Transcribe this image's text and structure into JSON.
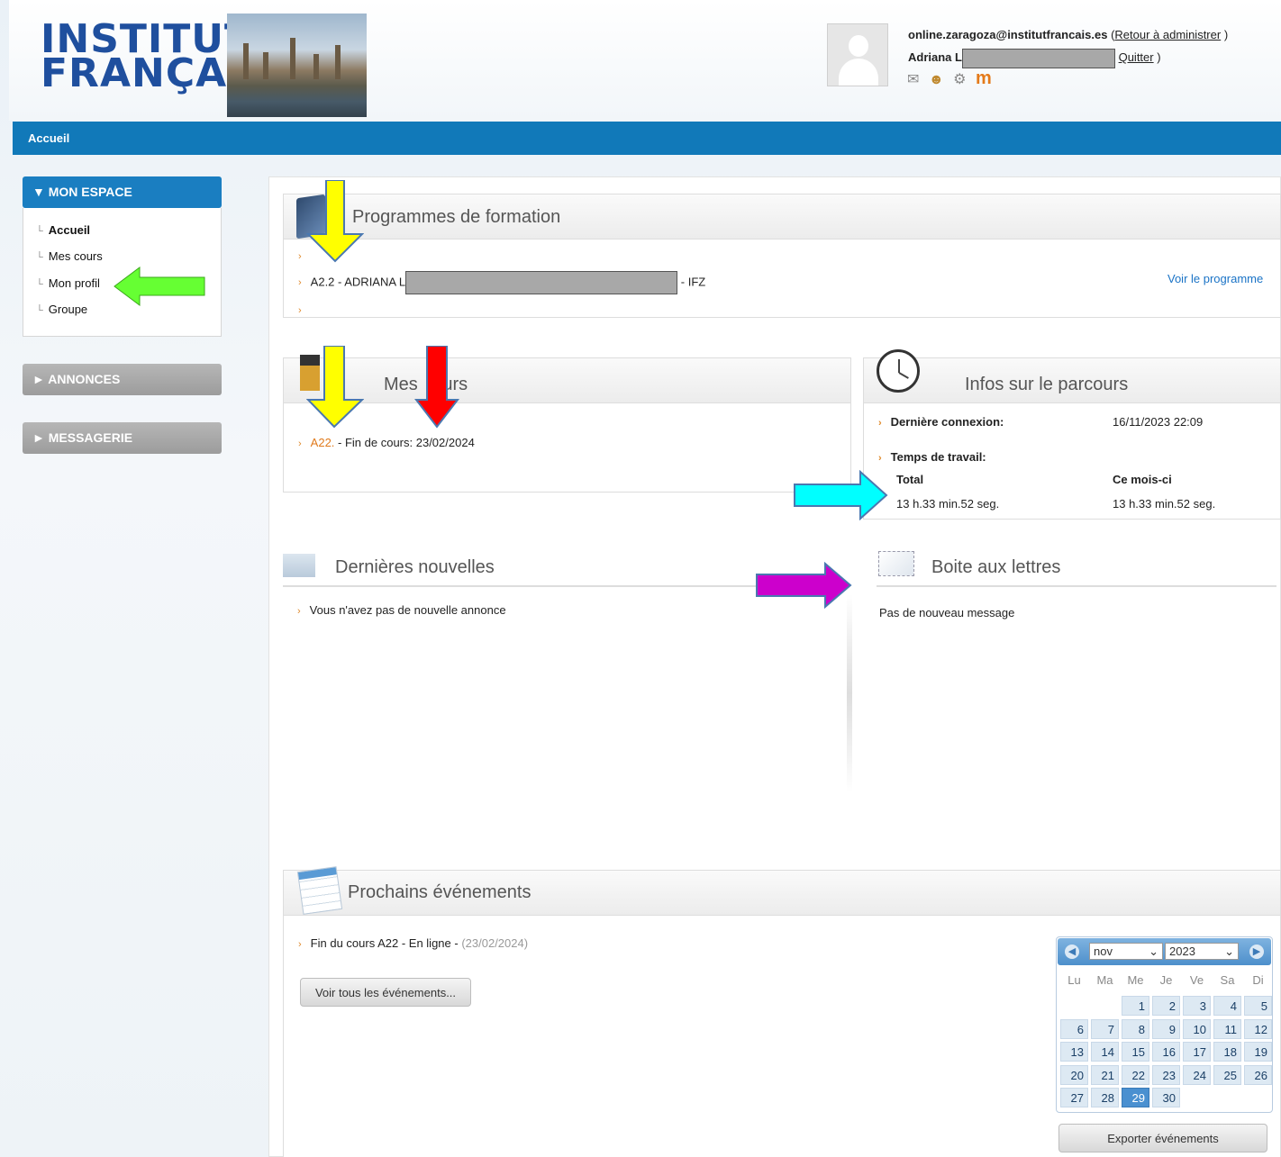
{
  "header": {
    "logo_line1": "INSTITUT",
    "logo_line2": "FRANÇAIS",
    "email": "online.zaragoza@institutfrancais.es",
    "paren_open": "(",
    "paren_close": ")",
    "return_admin": "Retour à administrer",
    "user_name": "Adriana L",
    "quit": "Quitter",
    "icons": [
      "mail-icon",
      "user-icon",
      "gear-icon",
      "moodle-icon"
    ]
  },
  "nav": {
    "home_tab": "Accueil"
  },
  "sidebar": {
    "mon_espace": "▼ MON ESPACE",
    "items": [
      {
        "label": "Accueil",
        "active": true
      },
      {
        "label": "Mes cours"
      },
      {
        "label": "Mon profil"
      },
      {
        "label": "Groupe"
      }
    ],
    "annonces": "► ANNONCES",
    "messagerie": "► MESSAGERIE"
  },
  "programmes": {
    "title": "Programmes de formation",
    "entry_prefix": "A2.2 - ADRIANA L",
    "entry_suffix": "- IFZ",
    "view_link": "Voir le programme"
  },
  "mes_cours": {
    "title_a": "Mes",
    "title_b": "urs",
    "course_link": "A22.",
    "course_text": " - Fin de cours: 23/02/2024"
  },
  "infos": {
    "title": "Infos sur le parcours",
    "last_login_label": "Dernière connexion:",
    "last_login_value": "16/11/2023 22:09",
    "work_time_label": "Temps de travail:",
    "total_label": "Total",
    "month_label": "Ce mois-ci",
    "total_value": "13 h.33 min.52 seg.",
    "month_value": "13 h.33 min.52 seg."
  },
  "news": {
    "title": "Dernières nouvelles",
    "empty": "Vous n'avez pas de nouvelle annonce"
  },
  "mailbox": {
    "title": "Boite aux lettres",
    "empty": "Pas de nouveau message"
  },
  "events": {
    "title": "Prochains événements",
    "item_text": "Fin du cours A22 - En ligne - ",
    "item_date": "(23/02/2024)",
    "view_all": "Voir tous les événements...",
    "export": "Exporter événements"
  },
  "calendar": {
    "month": "nov",
    "year": "2023",
    "weekdays": [
      "Lu",
      "Ma",
      "Me",
      "Je",
      "Ve",
      "Sa",
      "Di"
    ],
    "first_weekday_index": 2,
    "days_in_month": 30,
    "today": 29
  },
  "colors": {
    "brand_blue": "#1179b9",
    "annotation_yellow": "#ffff00",
    "annotation_red": "#ff0000",
    "annotation_green": "#66ff33",
    "annotation_cyan": "#00ffff",
    "annotation_magenta": "#cc00cc"
  }
}
